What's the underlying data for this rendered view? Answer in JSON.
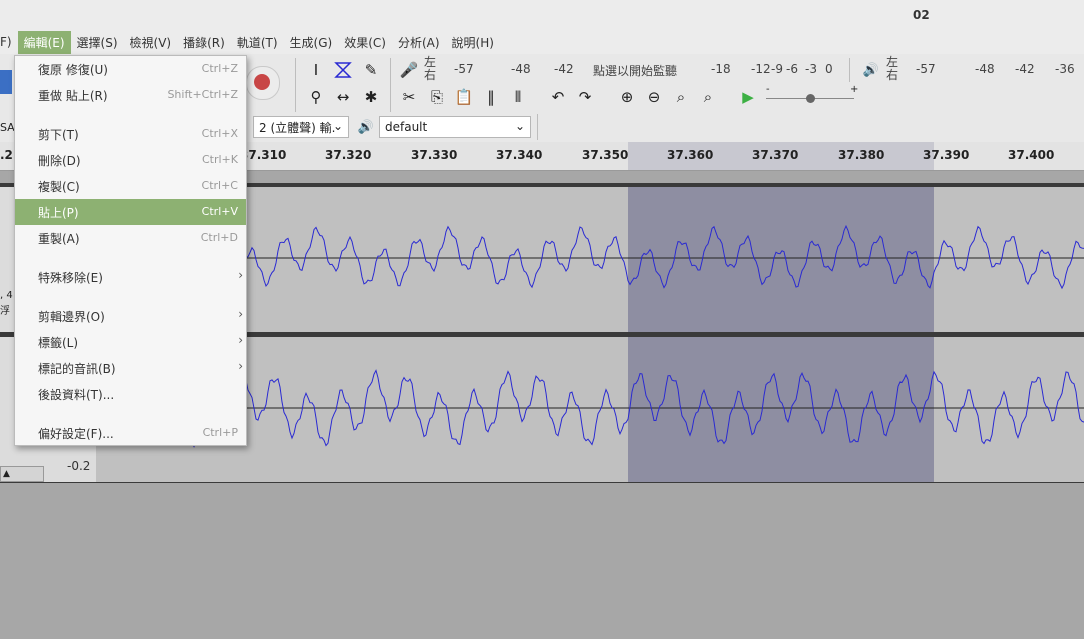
{
  "window": {
    "title": "02"
  },
  "menubar": {
    "items": [
      {
        "label": "F)"
      },
      {
        "label": "編輯(E)",
        "active": true
      },
      {
        "label": "選擇(S)"
      },
      {
        "label": "檢視(V)"
      },
      {
        "label": "播錄(R)"
      },
      {
        "label": "軌道(T)"
      },
      {
        "label": "生成(G)"
      },
      {
        "label": "效果(C)"
      },
      {
        "label": "分析(A)"
      },
      {
        "label": "說明(H)"
      }
    ]
  },
  "edit_menu": {
    "items": [
      {
        "label": "復原 修復(U)",
        "shortcut": "Ctrl+Z"
      },
      {
        "label": "重做 貼上(R)",
        "shortcut": "Shift+Ctrl+Z"
      },
      {
        "label": "剪下(T)",
        "shortcut": "Ctrl+X"
      },
      {
        "label": "刪除(D)",
        "shortcut": "Ctrl+K"
      },
      {
        "label": "複製(C)",
        "shortcut": "Ctrl+C"
      },
      {
        "label": "貼上(P)",
        "shortcut": "Ctrl+V",
        "highlighted": true
      },
      {
        "label": "重製(A)",
        "shortcut": "Ctrl+D"
      },
      {
        "label": "特殊移除(E)",
        "submenu": "›"
      },
      {
        "label": "剪輯邊界(O)",
        "submenu": "›"
      },
      {
        "label": "標籤(L)",
        "submenu": "›"
      },
      {
        "label": "標記的音訊(B)",
        "submenu": "›"
      },
      {
        "label": "後設資料(T)..."
      },
      {
        "label": "偏好設定(F)...",
        "shortcut": "Ctrl+P"
      }
    ]
  },
  "toolbar": {
    "record_meter": {
      "lr": "左\n右",
      "scale": [
        "-57",
        "-48",
        "-42",
        "-18",
        "-12",
        "-9",
        "-6",
        "-3",
        "0"
      ],
      "prompt": "點選以開始監聽"
    },
    "play_meter": {
      "lr": "左\n右",
      "scale": [
        "-57",
        "-48",
        "-42",
        "-36"
      ]
    },
    "channels_combo": "2 (立體聲) 輸.",
    "output_combo": "default",
    "host_fragment": "SA",
    "speed_slider": {
      "minus": "-",
      "plus": "+",
      "level": 0.5
    }
  },
  "ruler": {
    "left_fragment": ".2",
    "ticks": [
      "37.310",
      "37.320",
      "37.330",
      "37.340",
      "37.350",
      "37.360",
      "37.370",
      "37.380",
      "37.390",
      "37.400"
    ]
  },
  "track": {
    "scale_label": "-0.2",
    "info_fragments": [
      ", 4",
      "浮"
    ]
  },
  "colors": {
    "accent": "#8db172",
    "waveform": "#2a2ad2",
    "selection": "#8e8ea2",
    "track_bg": "#c0c0c0",
    "record": "#c84646",
    "play": "#3cb043"
  }
}
